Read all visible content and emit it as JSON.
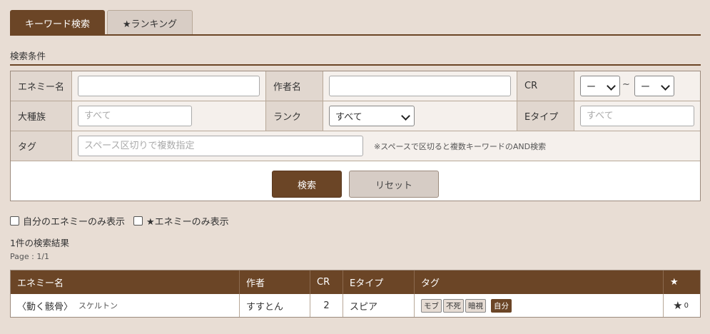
{
  "tabs": [
    {
      "label": "キーワード検索",
      "active": true
    },
    {
      "label": "★ランキング",
      "active": false
    }
  ],
  "section_title": "検索条件",
  "form": {
    "enemy_name_label": "エネミー名",
    "author_label": "作者名",
    "cr_label": "CR",
    "cr_min": "ー",
    "cr_max": "ー",
    "cr_sep": "~",
    "major_type_label": "大種族",
    "major_type_placeholder": "すべて",
    "rank_label": "ランク",
    "rank_value": "すべて",
    "etype_label": "Eタイプ",
    "etype_placeholder": "すべて",
    "tag_label": "タグ",
    "tag_placeholder": "スペース区切りで複数指定",
    "tag_note": "※スペースで区切ると複数キーワードのAND検索",
    "search_button": "検索",
    "reset_button": "リセット"
  },
  "filters": {
    "own_only": "自分のエネミーのみ表示",
    "star_only": "★エネミーのみ表示"
  },
  "result_count": "1件の検索結果",
  "page_info": "Page : 1/1",
  "results": {
    "headers": [
      "エネミー名",
      "作者",
      "CR",
      "Eタイプ",
      "タグ",
      "★"
    ],
    "rows": [
      {
        "name": "〈動く骸骨〉",
        "sub": "スケルトン",
        "author": "すすとん",
        "cr": "2",
        "etype": "スピア",
        "tags": [
          "モブ",
          "不死",
          "暗視"
        ],
        "own_tag": "自分",
        "star": "★",
        "stars": "0"
      }
    ]
  },
  "colors": {
    "accent": "#6b4526",
    "background": "#e8ddd4",
    "label_bg": "#e1d7cf"
  }
}
